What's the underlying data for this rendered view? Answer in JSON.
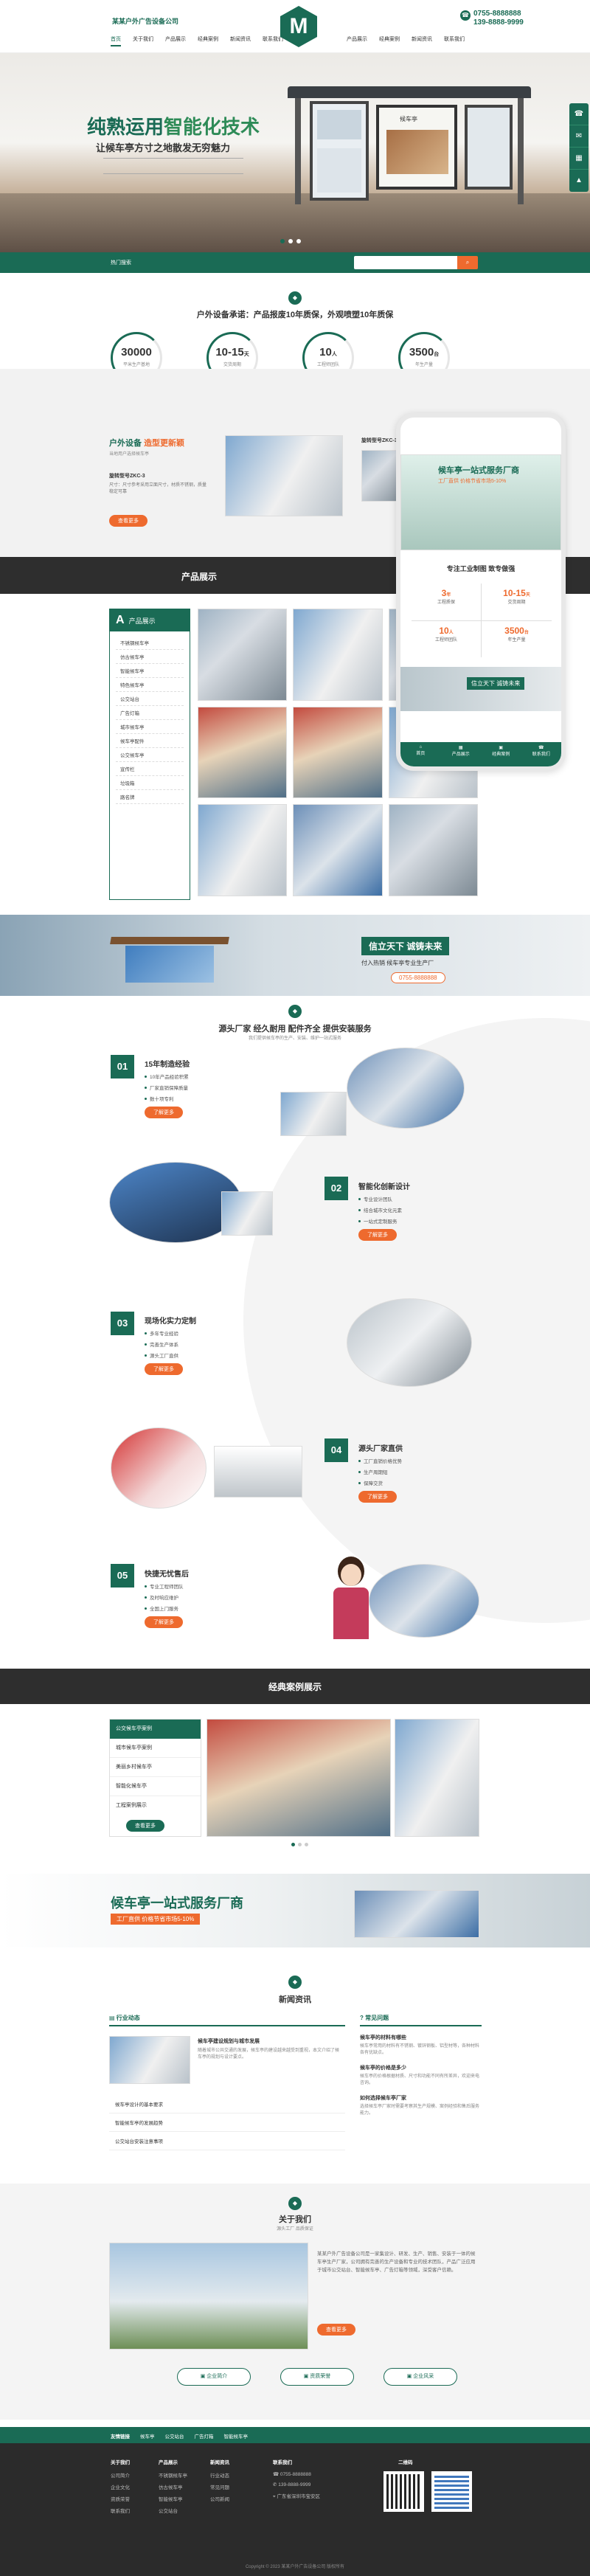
{
  "header": {
    "brand": "某某户外广告设备公司",
    "nav": [
      "首页",
      "关于我们",
      "产品展示",
      "经典案例",
      "新闻资讯",
      "联系我们"
    ],
    "nav_right": [
      "产品展示",
      "经典案例",
      "新闻资讯",
      "联系我们"
    ],
    "logo_letter": "M",
    "phone1": "0755-8888888",
    "phone2": "139-8888-9999"
  },
  "hero": {
    "title_pre": "纯熟运用",
    "title_hl": "智能化技术",
    "subtitle": "让候车亭方寸之地散发无穷魅力",
    "sign": "候车亭"
  },
  "search": {
    "hot_label": "热门搜索",
    "placeholder": ""
  },
  "commit": {
    "title": "户外设备承诺：产品报废10年质保，外观喷塑10年质保",
    "stats": [
      {
        "value": "30000",
        "unit": "",
        "label": "平米生产基地"
      },
      {
        "value": "10-15",
        "unit": "天",
        "label": "交货周期"
      },
      {
        "value": "10",
        "unit": "人",
        "label": "工程师团队"
      },
      {
        "value": "3500",
        "unit": "台",
        "label": "年生产量"
      }
    ]
  },
  "featured": {
    "brand": "户外设备",
    "brand_tag": "造型更新颖",
    "desc": "当地用户选择候车亭",
    "model": "旋转型号ZKC-3",
    "model_right": "旋转型号ZKC-3",
    "spec": "尺寸：尺寸参考采用立面尺寸，材质不锈钢，质量稳定可靠",
    "btn": "查看更多"
  },
  "phone_mock": {
    "banner_title": "候车亭一站式服务厂商",
    "banner_sub": "工厂直供 价格节省市场5-10%",
    "tagline": "专注工业制图 致专做强",
    "stats": [
      {
        "value": "3",
        "unit": "年",
        "label": "工程质保"
      },
      {
        "value": "10-15",
        "unit": "天",
        "label": "交货周期"
      },
      {
        "value": "10",
        "unit": "人",
        "label": "工程师团队"
      },
      {
        "value": "3500",
        "unit": "台",
        "label": "年生产量"
      }
    ],
    "slogan": "信立天下 诚铸未来",
    "nav": [
      "首页",
      "产品展示",
      "经典案例",
      "联系我们"
    ]
  },
  "products": {
    "title": "产品展示",
    "sidebar_title": "产品展示",
    "sidebar_letter": "A",
    "categories": [
      "不锈钢候车亭",
      "仿古候车亭",
      "智能候车亭",
      "特色候车亭",
      "公交站台",
      "广告灯箱",
      "城市候车亭",
      "候车亭配件",
      "公交候车亭",
      "宣传栏",
      "垃圾箱",
      "路名牌"
    ],
    "sub_items": [
      "不锈钢候车亭",
      "仿古候车亭",
      "智能候车亭",
      "公交站台",
      "广告灯箱"
    ]
  },
  "slogan_band": {
    "text": "信立天下 诚铸未来",
    "sub": "专注工业制图 致专做强",
    "phone": "0755-8888888",
    "desc": "付入热销 候车亭专业生产厂"
  },
  "source": {
    "title": "源头厂家 经久耐用 配件齐全 提供安装服务",
    "sub": "我们提供候车亭的生产、安装、维护一站式服务",
    "items": [
      {
        "num": "01",
        "title": "15年制造经验",
        "lines": [
          "10年产品经验积累",
          "厂家直销保障质量",
          "数十项专利"
        ],
        "btn": "了解更多"
      },
      {
        "num": "02",
        "title": "智能化创新设计",
        "lines": [
          "专业设计团队",
          "结合城市文化元素",
          "一站式定制服务"
        ],
        "btn": "了解更多"
      },
      {
        "num": "03",
        "title": "现场化实力定制",
        "lines": [
          "多年专业经验",
          "完善生产体系",
          "源头工厂直供"
        ],
        "btn": "了解更多"
      },
      {
        "num": "04",
        "title": "源头厂家直供",
        "lines": [
          "工厂直销价格优势",
          "生产周期短",
          "保障交货"
        ],
        "btn": "了解更多"
      },
      {
        "num": "05",
        "title": "快捷无忧售后",
        "lines": [
          "专业工程师团队",
          "及时响应维护",
          "全国上门服务"
        ],
        "btn": "了解更多"
      }
    ]
  },
  "cases": {
    "title": "经典案例展示",
    "tabs": [
      "公交候车亭案例",
      "城市候车亭案例",
      "美丽乡村候车亭",
      "智能化候车亭",
      "工程案例展示"
    ],
    "btn": "查看更多"
  },
  "banner2": {
    "title": "候车亭一站式服务厂商",
    "sub": "工厂直供 价格节省市场5-10%"
  },
  "news": {
    "title": "新闻资讯",
    "col1_title": "行业动态",
    "col2_title": "常见问题",
    "feature_title": "候车亭建设规划与城市发展",
    "feature_desc": "随着城市公共交通的发展，候车亭的建设越来越受到重视，本文介绍了候车亭的规划与设计要点。",
    "list1": [
      "候车亭设计的基本要求",
      "智能候车亭的发展趋势",
      "公交站台安装注意事项"
    ],
    "list2": [
      {
        "title": "候车亭的材料有哪些",
        "desc": "候车亭常用的材料有不锈钢、镀锌钢板、铝型材等，各种材料各有优缺点。"
      },
      {
        "title": "候车亭的价格是多少",
        "desc": "候车亭的价格根据材质、尺寸和功能不同有所差异，欢迎来电咨询。"
      },
      {
        "title": "如何选择候车亭厂家",
        "desc": "选择候车亭厂家时需要考察其生产规模、案例经验和售后服务能力。"
      }
    ]
  },
  "about": {
    "title": "关于我们",
    "sub": "源头工厂 品质保证",
    "desc": "某某户外广告设备公司是一家集设计、研发、生产、销售、安装于一体的候车亭生产厂家，公司拥有完善的生产设备和专业的技术团队，产品广泛应用于城市公交站台、智能候车亭、广告灯箱等领域，深受客户信赖。",
    "btn": "查看更多",
    "links": [
      "企业简介",
      "资质荣誉",
      "企业风采"
    ]
  },
  "footer": {
    "link_title": "友情链接",
    "links": [
      "候车亭",
      "公交站台",
      "广告灯箱",
      "智能候车亭"
    ],
    "cols": [
      {
        "title": "关于我们",
        "items": [
          "公司简介",
          "企业文化",
          "资质荣誉",
          "联系我们"
        ]
      },
      {
        "title": "产品展示",
        "items": [
          "不锈钢候车亭",
          "仿古候车亭",
          "智能候车亭",
          "公交站台"
        ]
      },
      {
        "title": "新闻资讯",
        "items": [
          "行业动态",
          "常见问题",
          "公司新闻"
        ]
      }
    ],
    "contact_title": "联系我们",
    "contact": [
      "0755-8888888",
      "139-8888-9999",
      "广东省深圳市宝安区"
    ],
    "qr_title": "二维码",
    "copyright": "Copyright © 2023 某某户外广告设备公司 版权所有"
  },
  "colors": {
    "primary": "#1a6b55",
    "accent": "#ee6a2e"
  }
}
